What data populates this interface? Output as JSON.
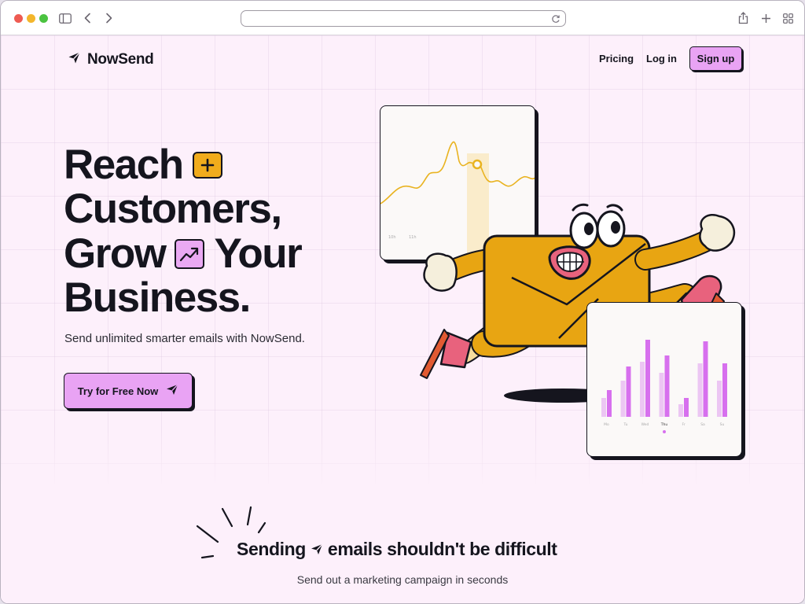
{
  "browser": {
    "url": ""
  },
  "nav": {
    "brand": "NowSend",
    "links": [
      "Pricing",
      "Log in"
    ],
    "signup_label": "Sign up"
  },
  "hero": {
    "line1": "Reach",
    "line2": "Customers,",
    "line3a": "Grow",
    "line3b": "Your",
    "line4": "Business.",
    "subtitle": "Send unlimited smarter emails with NowSend.",
    "cta_label": "Try for Free Now"
  },
  "bar_card": {
    "days": [
      "Mo",
      "Tu",
      "Wed",
      "Thu",
      "Fr",
      "Sa",
      "Su"
    ],
    "active_day": "Thu"
  },
  "line_card": {
    "ticks": [
      "10h",
      "11h"
    ]
  },
  "section2": {
    "headline_a": "Sending",
    "headline_b": "emails shouldn't be difficult",
    "subtitle": "Send out a marketing campaign in seconds"
  },
  "colors": {
    "accent_pink": "#e9a3f4",
    "mascot_yellow": "#e8a512",
    "bar_magenta": "#d770ee",
    "bar_light": "#ecc6f3",
    "line_yellow": "#e9b320"
  },
  "icons": [
    "sidebar-icon",
    "back-icon",
    "forward-icon",
    "reload-icon",
    "share-icon",
    "new-tab-icon",
    "tabs-grid-icon",
    "paper-plane-icon",
    "chat-plus-icon",
    "trend-up-icon"
  ]
}
